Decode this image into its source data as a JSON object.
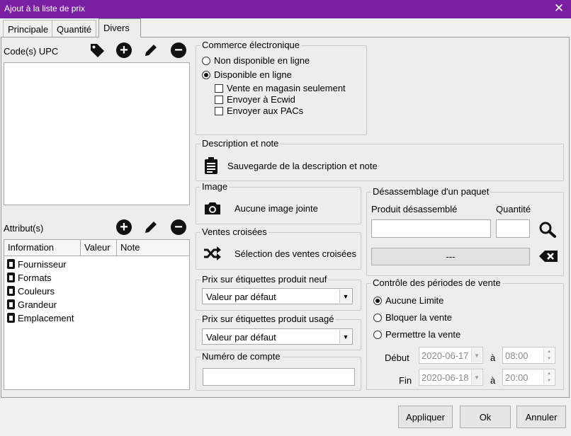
{
  "window": {
    "title": "Ajout à la liste de prix",
    "close_glyph": "✕"
  },
  "tabs": [
    {
      "label": "Principale"
    },
    {
      "label": "Quantité"
    },
    {
      "label": "Divers"
    }
  ],
  "active_tab": "Divers",
  "upc": {
    "label": "Code(s) UPC"
  },
  "attributes": {
    "label": "Attribut(s)",
    "columns": [
      "Information",
      "Valeur",
      "Note"
    ],
    "items": [
      "Fournisseur",
      "Formats",
      "Couleurs",
      "Grandeur",
      "Emplacement"
    ]
  },
  "ecommerce": {
    "title": "Commerce électronique",
    "options": [
      {
        "label": "Non disponible en ligne",
        "selected": false
      },
      {
        "label": "Disponible en ligne",
        "selected": true
      }
    ],
    "checks": [
      {
        "label": "Vente en magasin seulement",
        "checked": false
      },
      {
        "label": "Envoyer à Ecwid",
        "checked": false
      },
      {
        "label": "Envoyer aux PACs",
        "checked": false
      }
    ]
  },
  "description": {
    "title": "Description et note",
    "action": "Sauvegarde de la description et note"
  },
  "image": {
    "title": "Image",
    "text": "Aucune image jointe"
  },
  "cross_sales": {
    "title": "Ventes croisées",
    "action": "Sélection des ventes croisées"
  },
  "price_new": {
    "title": "Prix sur étiquettes produit neuf",
    "value": "Valeur par défaut"
  },
  "price_used": {
    "title": "Prix sur étiquettes produit usagé",
    "value": "Valeur par défaut"
  },
  "account": {
    "title": "Numéro de compte",
    "value": ""
  },
  "disassembly": {
    "title": "Désassemblage d'un paquet",
    "product_label": "Produit désassemblé",
    "product_value": "",
    "qty_label": "Quantité",
    "qty_value": "",
    "list_button": "---"
  },
  "sale_periods": {
    "title": "Contrôle des périodes de vente",
    "options": [
      {
        "label": "Aucune Limite",
        "selected": true
      },
      {
        "label": "Bloquer la vente",
        "selected": false
      },
      {
        "label": "Permettre la vente",
        "selected": false
      }
    ],
    "start_label": "Début",
    "end_label": "Fin",
    "at_label": "à",
    "start_date": "2020-06-17",
    "start_time": "08:00",
    "end_date": "2020-06-18",
    "end_time": "20:00"
  },
  "footer": {
    "apply": "Appliquer",
    "ok": "Ok",
    "cancel": "Annuler"
  },
  "colors": {
    "titlebar": "#7a1fa2"
  }
}
